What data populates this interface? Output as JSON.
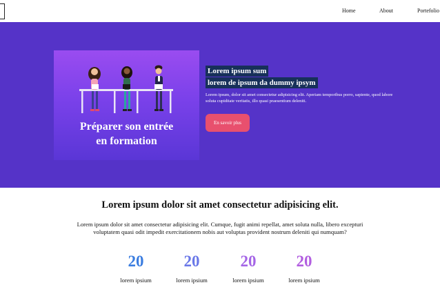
{
  "nav": {
    "items": [
      {
        "label": "Home"
      },
      {
        "label": "About"
      },
      {
        "label": "Portefolio"
      }
    ]
  },
  "hero": {
    "card_title_line1": "Préparer son entrée",
    "card_title_line2": "en formation",
    "heading_line1": "Lorem ipsum sum",
    "heading_line2": "lorem de ipsum da dummy ipsym",
    "body": "Lorem ipsum, dolor sit amet consectetur adipisicing elit. Aperiam temporibus porro, sapiente, quod labore soluta cupiditate veritatis, illo quasi praesentium deleniti.",
    "button_label": "En savoir plus",
    "colors": {
      "background": "#5533c8",
      "button": "#e8506e",
      "highlight": "#17305a"
    }
  },
  "section": {
    "title": "Lorem ipsum dolor sit amet consectetur adipisicing elit.",
    "text": "Lorem ipsum dolor sit amet consectetur adipisicing elit. Cumque, fugit animi repellat, amet soluta nulla, libero excepturi voluptatem quasi odit impedit exercitationem nobis aut voluptas provident nostrum deleniti qui numquam?"
  },
  "stats": [
    {
      "value": "20",
      "label": "lorem ipsium",
      "color": "#3b7de0"
    },
    {
      "value": "20",
      "label": "lorem ipsium",
      "color": "#6a78e8"
    },
    {
      "value": "20",
      "label": "lorem ipsium",
      "color": "#a465e6"
    },
    {
      "value": "20",
      "label": "lorem ipsium",
      "color": "#b25ee0"
    }
  ]
}
